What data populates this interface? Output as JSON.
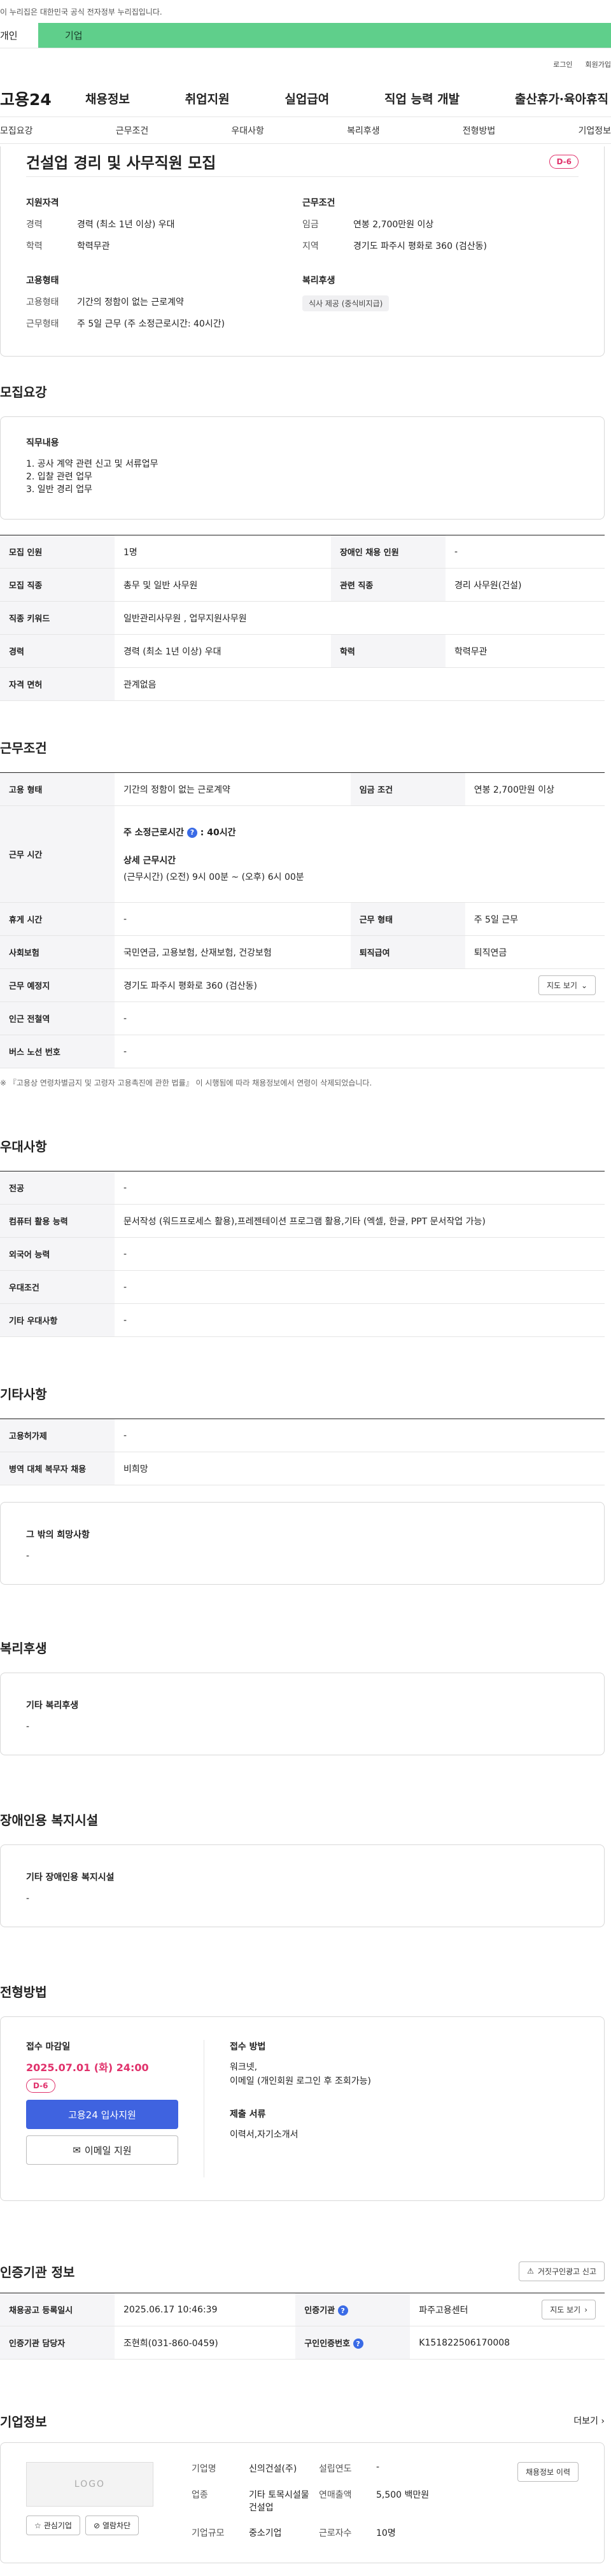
{
  "topnote": "이 누리집은 대한민국 공식 전자정부 누리집입니다.",
  "tabs": {
    "person": "개인",
    "biz": "기업"
  },
  "util": {
    "login": "로그인",
    "join": "회원가입"
  },
  "logo": "고용24",
  "gnb": [
    "채용정보",
    "취업지원",
    "실업급여",
    "직업 능력 개발",
    "출산휴가·육아휴직"
  ],
  "anchors": [
    "모집요강",
    "근무조건",
    "우대사항",
    "복리후생",
    "전형방법",
    "기업정보"
  ],
  "header": {
    "title": "건설업 경리 및 사무직원 모집",
    "dday": "D-6",
    "qual_title": "지원자격",
    "qual": [
      {
        "k": "경력",
        "v": "경력 (최소 1년 이상) 우대"
      },
      {
        "k": "학력",
        "v": "학력무관"
      }
    ],
    "emp_title": "고용형태",
    "emp": [
      {
        "k": "고용형태",
        "v": "기간의 정함이 없는 근로계약"
      },
      {
        "k": "근무형태",
        "v": "주 5일 근무 (주 소정근로시간: 40시간)"
      }
    ],
    "cond_title": "근무조건",
    "cond": [
      {
        "k": "임금",
        "v": "연봉 2,700만원 이상"
      },
      {
        "k": "지역",
        "v": "경기도 파주시 평화로 360 (검산동)"
      }
    ],
    "welfare_title": "복리후생",
    "welfare_chip": "식사 제공 (중식비지급)"
  },
  "recruit": {
    "section": "모집요강",
    "duty_title": "직무내용",
    "duty_lines": [
      "1. 공사 계약 관련  신고 및 서류업무",
      "2. 입찰 관련 업무",
      "3. 일반 경리 업무"
    ],
    "rows": [
      {
        "k1": "모집 인원",
        "v1": "1명",
        "k2": "장애인 채용 인원",
        "v2": "-"
      },
      {
        "k1": "모집 직종",
        "v1": "총무 및 일반 사무원",
        "k2": "관련 직종",
        "v2": "경리 사무원(건설)"
      },
      {
        "k1": "직종 키워드",
        "v1": "일반관리사무원 , 업무지원사무원"
      },
      {
        "k1": "경력",
        "v1": "경력 (최소 1년 이상) 우대",
        "k2": "학력",
        "v2": "학력무관"
      },
      {
        "k1": "자격 면허",
        "v1": "관계없음"
      }
    ]
  },
  "work": {
    "section": "근무조건",
    "r1": {
      "k1": "고용 형태",
      "v1": "기간의 정함이 없는 근로계약",
      "k2": "임금 조건",
      "v2": "연봉 2,700만원 이상"
    },
    "hours_label": "근무 시간",
    "hours_main": "주 소정근로시간",
    "hours_main_val": ": 40시간",
    "hours_detail_title": "상세 근무시간",
    "hours_detail": "(근무시간) (오전) 9시 00분 ~ (오후) 6시 00분",
    "r3": {
      "k1": "휴게 시간",
      "v1": "-",
      "k2": "근무 형태",
      "v2": "주 5일 근무"
    },
    "r4": {
      "k1": "사회보험",
      "v1": "국민연금, 고용보험, 산재보험, 건강보험",
      "k2": "퇴직급여",
      "v2": "퇴직연금"
    },
    "r5": {
      "k1": "근무 예정지",
      "v1": "경기도 파주시 평화로 360 (검산동)",
      "btn": "지도 보기"
    },
    "r6": {
      "k1": "인근 전철역",
      "v1": "-"
    },
    "r7": {
      "k1": "버스 노선 번호",
      "v1": "-"
    },
    "note": "※ 『고용상 연령차별금지 및 고령자 고용촉진에 관한 법률』 이 시행됨에 따라 채용정보에서 연령이 삭제되었습니다."
  },
  "pref": {
    "section": "우대사항",
    "rows": [
      {
        "k": "전공",
        "v": "-"
      },
      {
        "k": "컴퓨터 활용 능력",
        "v": "문서작성 (워드프로세스 활용),프레젠테이션 프로그램 활용,기타 (엑셀, 한글, PPT 문서작업 가능)"
      },
      {
        "k": "외국어 능력",
        "v": "-"
      },
      {
        "k": "우대조건",
        "v": "-"
      },
      {
        "k": "기타 우대사항",
        "v": "-"
      }
    ]
  },
  "etc": {
    "section": "기타사항",
    "rows": [
      {
        "k": "고용허가제",
        "v": "-"
      },
      {
        "k": "병역 대체 복무자 채용",
        "v": "비희망"
      }
    ],
    "box_title": "그 밖의 희망사항",
    "box_text": "-"
  },
  "welfare": {
    "section": "복리후생",
    "box_title": "기타 복리후생",
    "box_text": "-"
  },
  "disabled": {
    "section": "장애인용 복지시설",
    "box_title": "기타 장애인용 복지시설",
    "box_text": "-"
  },
  "apply": {
    "section": "전형방법",
    "deadline_title": "접수 마감일",
    "deadline": "2025.07.01 (화) 24:00",
    "dday": "D-6",
    "apply_btn": "고용24 입사지원",
    "email_btn": "이메일 지원",
    "method_title": "접수 방법",
    "method_lines": [
      "워크넷,",
      "이메일 (개인회원 로그인 후 조회가능)"
    ],
    "docs_title": "제출 서류",
    "docs": "이력서,자기소개서"
  },
  "cert": {
    "section": "인증기관 정보",
    "report_btn": "거짓구인광고 신고",
    "r1": {
      "k1": "채용공고 등록일시",
      "v1": "2025.06.17 10:46:39",
      "k2": "인증기관",
      "v2": "파주고용센터",
      "btn": "지도 보기"
    },
    "r2": {
      "k1": "인증기관 담당자",
      "v1": "조현희(031-860-0459)",
      "k2": "구인인증번호",
      "v2": "K151822506170008"
    }
  },
  "company": {
    "section": "기업정보",
    "more": "더보기",
    "logo_text": "LOGO",
    "fav_btn": "관심기업",
    "block_btn": "열람차단",
    "fields": [
      {
        "k": "기업명",
        "v": "신의건설(주)"
      },
      {
        "k": "설립연도",
        "v": "-"
      },
      {
        "k": "업종",
        "v": "기타 토목시설물 건설업"
      },
      {
        "k": "연매출액",
        "v": "5,500 백만원"
      },
      {
        "k": "기업규모",
        "v": "중소기업"
      },
      {
        "k": "근로자수",
        "v": "10명"
      }
    ],
    "jobs_btn": "채용정보 이력"
  }
}
